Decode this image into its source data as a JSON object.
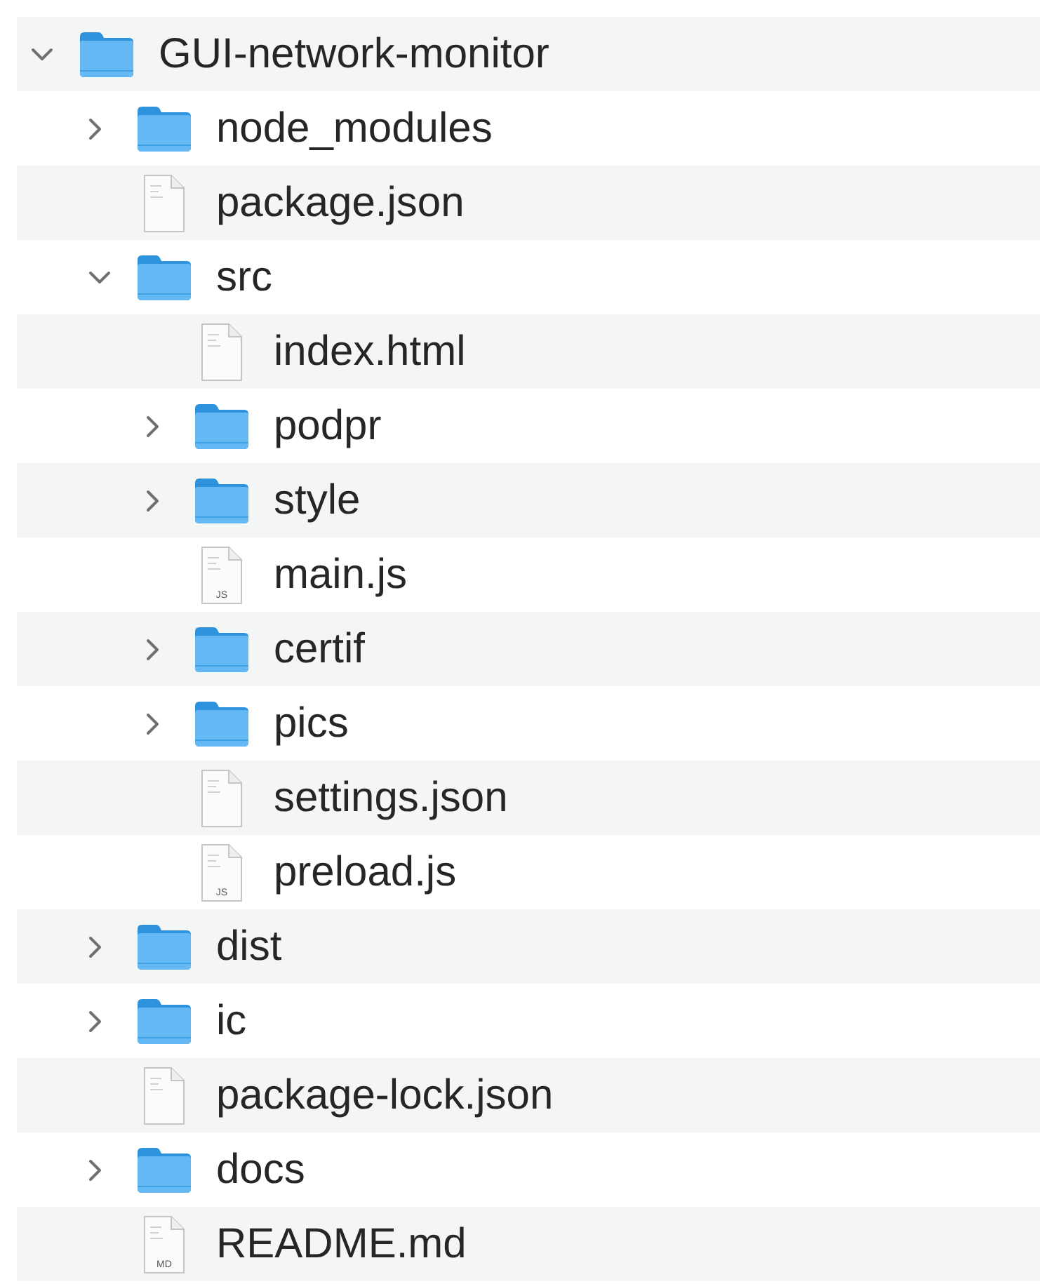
{
  "tree": [
    {
      "kind": "folder",
      "name": "GUI-network-monitor",
      "expanded": true,
      "children": [
        {
          "kind": "folder",
          "name": "node_modules",
          "expanded": false
        },
        {
          "kind": "file",
          "name": "package.json"
        },
        {
          "kind": "folder",
          "name": "src",
          "expanded": true,
          "children": [
            {
              "kind": "file",
              "name": "index.html"
            },
            {
              "kind": "folder",
              "name": "podpr",
              "expanded": false
            },
            {
              "kind": "folder",
              "name": "style",
              "expanded": false
            },
            {
              "kind": "file",
              "name": "main.js",
              "icon_label": "JS"
            },
            {
              "kind": "folder",
              "name": "certif",
              "expanded": false
            },
            {
              "kind": "folder",
              "name": "pics",
              "expanded": false
            },
            {
              "kind": "file",
              "name": "settings.json"
            },
            {
              "kind": "file",
              "name": "preload.js",
              "icon_label": "JS"
            }
          ]
        },
        {
          "kind": "folder",
          "name": "dist",
          "expanded": false
        },
        {
          "kind": "folder",
          "name": "ic",
          "expanded": false
        },
        {
          "kind": "file",
          "name": "package-lock.json"
        },
        {
          "kind": "folder",
          "name": "docs",
          "expanded": false
        },
        {
          "kind": "file",
          "name": "README.md",
          "icon_label": "MD"
        }
      ]
    }
  ]
}
